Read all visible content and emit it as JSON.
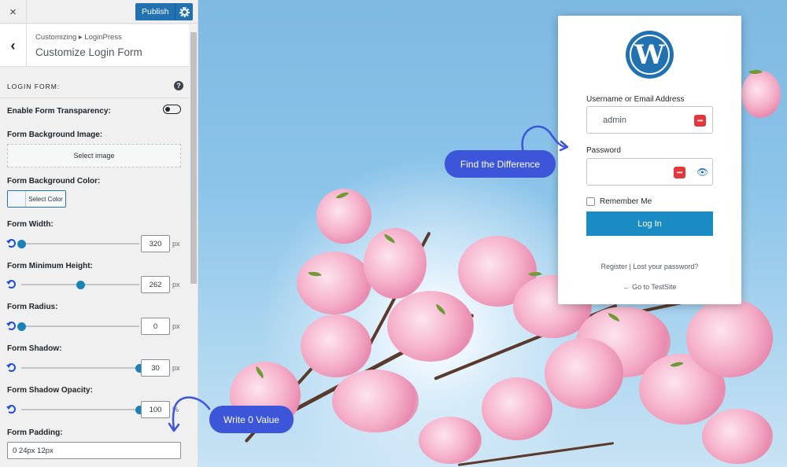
{
  "topbar": {
    "close_glyph": "×",
    "publish_label": "Publish",
    "settings_icon": "gear-icon"
  },
  "section": {
    "breadcrumb": "Customizing ▸ LoginPress",
    "title": "Customize Login Form",
    "back_glyph": "‹"
  },
  "panel": {
    "label": "LOGIN FORM:",
    "help_glyph": "?"
  },
  "fields": {
    "transparency_label": "Enable Form Transparency:",
    "bg_image_label": "Form Background Image:",
    "select_image": "Select image",
    "bg_color_label": "Form Background Color:",
    "select_color": "Select Color",
    "padding_label": "Form Padding:",
    "padding_value": "0 24px 12px"
  },
  "sliders": [
    {
      "label": "Form Width:",
      "value": "320",
      "unit": "px",
      "level": 0.0
    },
    {
      "label": "Form Minimum Height:",
      "value": "262",
      "unit": "px",
      "level": 0.5
    },
    {
      "label": "Form Radius:",
      "value": "0",
      "unit": "px",
      "level": 0.0
    },
    {
      "label": "Form Shadow:",
      "value": "30",
      "unit": "px",
      "level": 1.0
    },
    {
      "label": "Form Shadow Opacity:",
      "value": "100",
      "unit": "%",
      "level": 1.0
    }
  ],
  "login": {
    "username_label": "Username or Email Address",
    "username_value": "admin",
    "password_label": "Password",
    "remember_label": "Remember Me",
    "login_button": "Log In",
    "links": "Register | Lost your password?",
    "back_link": "← Go to TestSite",
    "pm_glyph": "•••",
    "eye_glyph": "👁"
  },
  "annotations": {
    "find_difference": "Find the Difference",
    "write_zero": "Write 0 Value"
  },
  "colors": {
    "accent": "#2271b1",
    "annotation": "#3d55d9",
    "login_button": "#1b8bc4",
    "slider_thumb": "#1b82b8"
  }
}
